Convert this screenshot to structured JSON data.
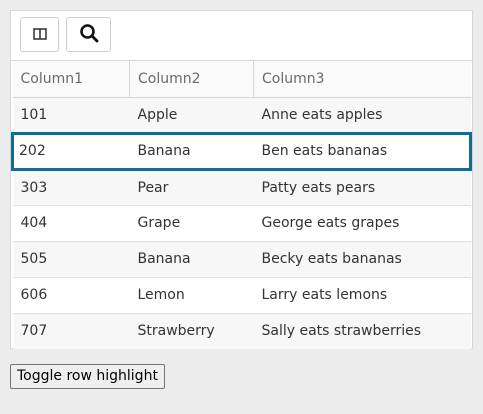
{
  "toolbar": {
    "columns_icon": "columns-icon",
    "search_icon": "search-icon"
  },
  "table": {
    "headers": [
      "Column1",
      "Column2",
      "Column3"
    ],
    "rows": [
      [
        "101",
        "Apple",
        "Anne eats apples"
      ],
      [
        "202",
        "Banana",
        "Ben eats bananas"
      ],
      [
        "303",
        "Pear",
        "Patty eats pears"
      ],
      [
        "404",
        "Grape",
        "George eats grapes"
      ],
      [
        "505",
        "Banana",
        "Becky eats bananas"
      ],
      [
        "606",
        "Lemon",
        "Larry eats lemons"
      ],
      [
        "707",
        "Strawberry",
        "Sally eats strawberries"
      ]
    ],
    "highlighted_row": 1
  },
  "toggle_button": {
    "label": "Toggle row highlight"
  },
  "colors": {
    "highlight": "#116d91"
  }
}
